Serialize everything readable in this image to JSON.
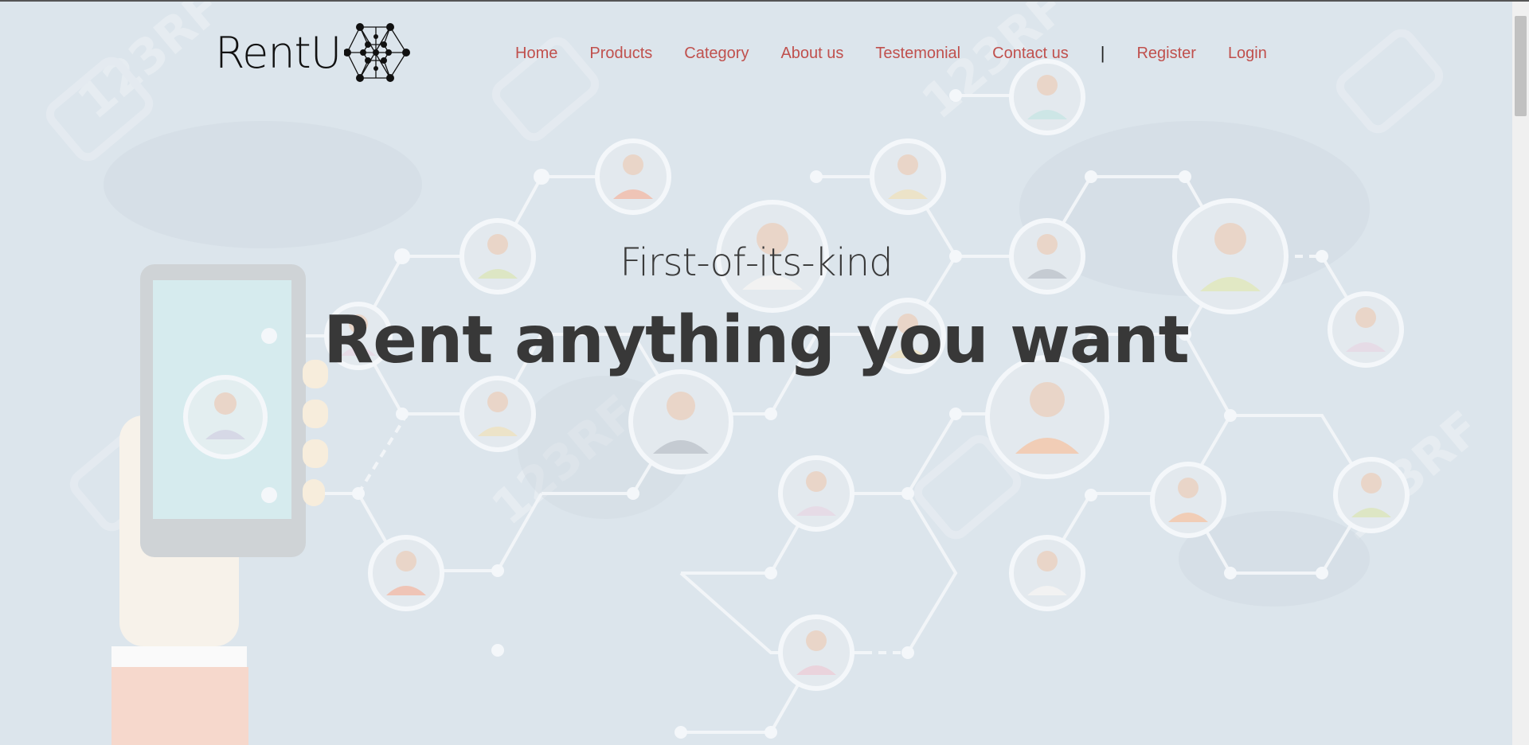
{
  "brand": {
    "name": "RentU"
  },
  "nav": {
    "items": [
      "Home",
      "Products",
      "Category",
      "About us",
      "Testemonial",
      "Contact us"
    ],
    "separator": "|",
    "auth": [
      "Register",
      "Login"
    ]
  },
  "hero": {
    "subtitle": "First-of-its-kind",
    "headline": "Rent anything you want",
    "watermark": "123RF"
  },
  "colors": {
    "nav_link": "#c0504d",
    "background": "#dce5ec",
    "headline": "#383838"
  }
}
